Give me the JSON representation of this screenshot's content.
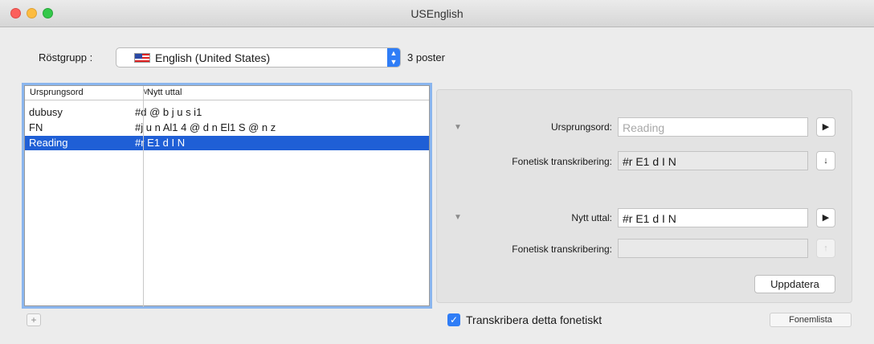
{
  "window": {
    "title": "USEnglish"
  },
  "voice_group": {
    "label": "Röstgrupp :",
    "selected": "English (United States)",
    "count_text": "3 poster"
  },
  "table": {
    "columns": [
      "Ursprungsord",
      "Nytt uttal"
    ],
    "sort_indicator": "∨",
    "rows": [
      {
        "original": "dubusy",
        "pronunciation": "#d @ b j u s i1",
        "selected": false
      },
      {
        "original": "FN",
        "pronunciation": "#j u n Al1 4 @ d n El1 S @ n z",
        "selected": false
      },
      {
        "original": "Reading",
        "pronunciation": "#r E1 d I N",
        "selected": true
      }
    ]
  },
  "add_button": "+",
  "detail": {
    "original_section": {
      "label": "Ursprungsord:",
      "placeholder": "Reading",
      "phonetic_label": "Fonetisk transkribering:",
      "phonetic_value": "#r E1 d I N"
    },
    "new_section": {
      "label": "Nytt uttal:",
      "value": "#r E1 d I N",
      "phonetic_label": "Fonetisk transkribering:",
      "phonetic_value": ""
    },
    "update_button": "Uppdatera"
  },
  "footer": {
    "checkbox_label": "Transkribera detta fonetiskt",
    "checkbox_checked": true,
    "phoneme_list_button": "Fonemlista"
  },
  "colors": {
    "accent": "#2f7df6",
    "selection": "#1f5fd6",
    "focus_ring": "#8bb6ee"
  }
}
